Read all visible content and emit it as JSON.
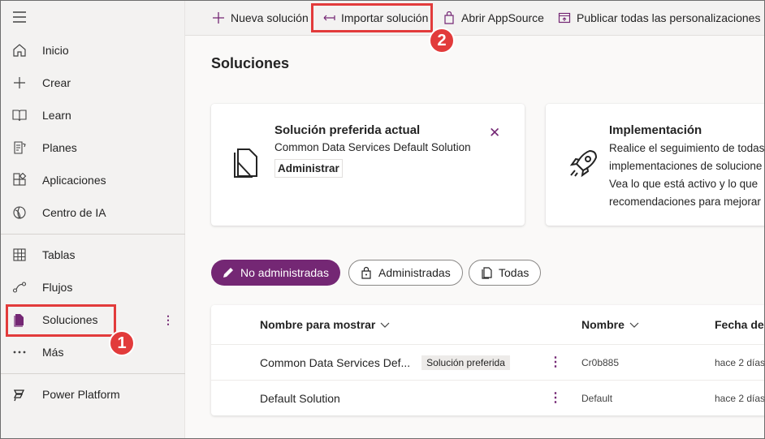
{
  "sidebar": {
    "items": [
      {
        "label": "Inicio",
        "icon": "home-icon"
      },
      {
        "label": "Crear",
        "icon": "plus-icon"
      },
      {
        "label": "Learn",
        "icon": "book-icon"
      },
      {
        "label": "Planes",
        "icon": "plan-icon"
      },
      {
        "label": "Aplicaciones",
        "icon": "apps-icon"
      },
      {
        "label": "Centro de IA",
        "icon": "ai-hub-icon"
      },
      {
        "label": "Tablas",
        "icon": "table-icon"
      },
      {
        "label": "Flujos",
        "icon": "flow-icon"
      },
      {
        "label": "Soluciones",
        "icon": "solutions-icon"
      },
      {
        "label": "Más",
        "icon": "more-icon"
      },
      {
        "label": "Power Platform",
        "icon": "power-platform-icon"
      }
    ],
    "more_glyph": "⋮"
  },
  "commandbar": {
    "new_solution": "Nueva solución",
    "import_solution": "Importar solución",
    "open_appsource": "Abrir AppSource",
    "publish_all": "Publicar todas las personalizaciones"
  },
  "page": {
    "title": "Soluciones"
  },
  "preferred_card": {
    "title": "Solución preferida actual",
    "solution": "Common Data Services Default Solution",
    "manage_button": "Administrar",
    "close_glyph": "✕"
  },
  "deploy_card": {
    "title": "Implementación",
    "lines": [
      "Realice el seguimiento de todas",
      "implementaciones de solucione",
      "Vea lo que está activo y lo que",
      "recomendaciones para mejorar"
    ]
  },
  "filters": {
    "unmanaged": "No administradas",
    "managed": "Administradas",
    "all": "Todas"
  },
  "table": {
    "headers": {
      "display_name": "Nombre para mostrar",
      "name": "Nombre",
      "date": "Fecha de"
    },
    "rows": [
      {
        "display": "Common Data Services Def...",
        "badge": "Solución preferida",
        "name": "Cr0b885",
        "date": "hace 2 días"
      },
      {
        "display": "Default Solution",
        "badge": "",
        "name": "Default",
        "date": "hace 2 días"
      }
    ],
    "row_menu_glyph": "⋮"
  },
  "annotations": {
    "step1": "1",
    "step2": "2"
  },
  "colors": {
    "accent": "#742774",
    "highlight": "#e23b3b"
  }
}
